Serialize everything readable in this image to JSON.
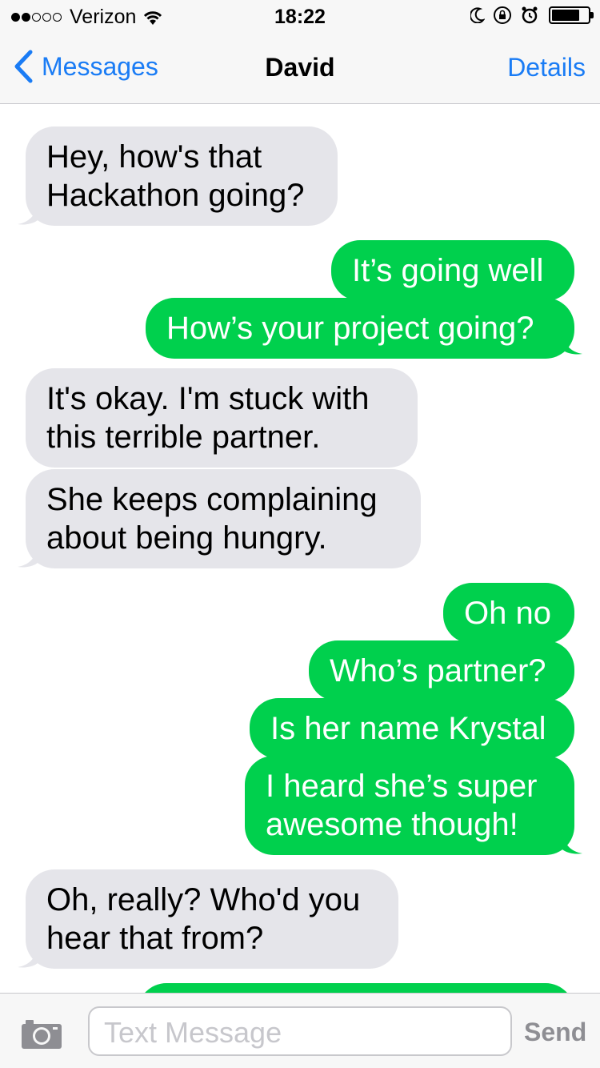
{
  "status": {
    "carrier": "Verizon",
    "time": "18:22",
    "signal_bars_filled": 2,
    "signal_bars_total": 5
  },
  "nav": {
    "back_label": "Messages",
    "title": "David",
    "details_label": "Details"
  },
  "messages": [
    {
      "from": "them",
      "text": [
        "Hey, how's that",
        "Hackathon going?"
      ]
    },
    {
      "from": "me",
      "text": [
        "It’s going well"
      ]
    },
    {
      "from": "me",
      "text": [
        "How’s your project going?"
      ]
    },
    {
      "from": "them",
      "text": [
        "It's okay. I'm stuck with",
        "this terrible partner."
      ]
    },
    {
      "from": "them",
      "text": [
        "She keeps complaining",
        "about being hungry."
      ]
    },
    {
      "from": "me",
      "text": [
        "Oh no"
      ]
    },
    {
      "from": "me",
      "text": [
        "Who’s partner?"
      ]
    },
    {
      "from": "me",
      "text": [
        "Is her name Krystal"
      ]
    },
    {
      "from": "me",
      "text": [
        "I heard she’s super",
        "awesome though!"
      ]
    },
    {
      "from": "them",
      "text": [
        "Oh, really? Who'd you",
        "hear that from?"
      ]
    }
  ],
  "input": {
    "placeholder": "Text Message",
    "send_label": "Send"
  },
  "colors": {
    "accent_blue": "#1a7cf5",
    "outgoing_bubble": "#00d04d",
    "incoming_bubble": "#e5e5ea"
  }
}
